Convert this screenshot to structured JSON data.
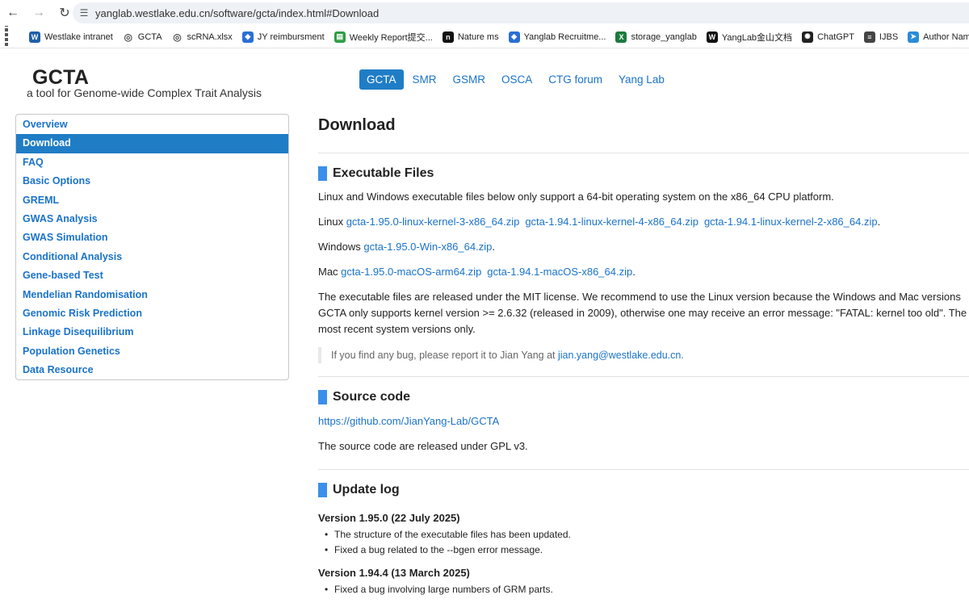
{
  "browser": {
    "url": "yanglab.westlake.edu.cn/software/gcta/index.html#Download",
    "bookmarks": [
      {
        "label": "Westlake intranet",
        "icon": "westlake-icon",
        "color": "#1f5fa8"
      },
      {
        "label": "GCTA",
        "icon": "globe-icon",
        "color": "#555555"
      },
      {
        "label": "scRNA.xlsx",
        "icon": "globe-icon",
        "color": "#555555"
      },
      {
        "label": "JY reimbursment",
        "icon": "cube-icon",
        "color": "#2a6fd6"
      },
      {
        "label": "Weekly Report提交...",
        "icon": "sheet-icon",
        "color": "#2f9e44"
      },
      {
        "label": "Nature ms",
        "icon": "nature-icon",
        "color": "#111111"
      },
      {
        "label": "Yanglab Recruitme...",
        "icon": "cube-icon",
        "color": "#2a6fd6"
      },
      {
        "label": "storage_yanglab",
        "icon": "excel-icon",
        "color": "#1d7a3e"
      },
      {
        "label": "YangLab金山文档",
        "icon": "wps-icon",
        "color": "#111111"
      },
      {
        "label": "ChatGPT",
        "icon": "chatgpt-icon",
        "color": "#222222"
      },
      {
        "label": "IJBS",
        "icon": "ijbs-icon",
        "color": "#444444"
      },
      {
        "label": "Author Name Esti...",
        "icon": "bird-icon",
        "color": "#2a8cd6"
      }
    ]
  },
  "site": {
    "title": "GCTA",
    "subtitle": "a tool for Genome-wide Complex Trait Analysis",
    "nav": [
      {
        "label": "GCTA",
        "active": true
      },
      {
        "label": "SMR",
        "active": false
      },
      {
        "label": "GSMR",
        "active": false
      },
      {
        "label": "OSCA",
        "active": false
      },
      {
        "label": "CTG forum",
        "active": false
      },
      {
        "label": "Yang Lab",
        "active": false
      }
    ]
  },
  "sidebar": {
    "items": [
      {
        "label": "Overview",
        "active": false
      },
      {
        "label": "Download",
        "active": true
      },
      {
        "label": "FAQ",
        "active": false
      },
      {
        "label": "Basic Options",
        "active": false
      },
      {
        "label": "GREML",
        "active": false
      },
      {
        "label": "GWAS Analysis",
        "active": false
      },
      {
        "label": "GWAS Simulation",
        "active": false
      },
      {
        "label": "Conditional Analysis",
        "active": false
      },
      {
        "label": "Gene-based Test",
        "active": false
      },
      {
        "label": "Mendelian Randomisation",
        "active": false
      },
      {
        "label": "Genomic Risk Prediction",
        "active": false
      },
      {
        "label": "Linkage Disequilibrium",
        "active": false
      },
      {
        "label": "Population Genetics",
        "active": false
      },
      {
        "label": "Data Resource",
        "active": false
      }
    ]
  },
  "main": {
    "title": "Download",
    "exec": {
      "heading": "Executable Files",
      "intro": "Linux and Windows executable files below only support a 64-bit operating system on the x86_64 CPU platform.",
      "linux_label": "Linux",
      "linux_links": [
        "gcta-1.95.0-linux-kernel-3-x86_64.zip",
        "gcta-1.94.1-linux-kernel-4-x86_64.zip",
        "gcta-1.94.1-linux-kernel-2-x86_64.zip"
      ],
      "windows_label": "Windows",
      "windows_links": [
        "gcta-1.95.0-Win-x86_64.zip"
      ],
      "mac_label": "Mac",
      "mac_links": [
        "gcta-1.95.0-macOS-arm64.zip",
        "gcta-1.94.1-macOS-x86_64.zip"
      ],
      "period": ".",
      "license_lines": [
        "The executable files are released under the MIT license. We recommend to use the Linux version because the Windows and Mac versions",
        "GCTA only supports kernel version >= 2.6.32 (released in 2009), otherwise one may receive an error message: \"FATAL: kernel too old\". The",
        "most recent system versions only."
      ],
      "bug_text": "If you find any bug, please report it to Jian Yang at ",
      "bug_email": "jian.yang@westlake.edu.cn",
      "bug_end": "."
    },
    "source": {
      "heading": "Source code",
      "link": "https://github.com/JianYang-Lab/GCTA",
      "license": "The source code are released under GPL v3."
    },
    "log": {
      "heading": "Update log",
      "versions": [
        {
          "title": "Version 1.95.0 (22 July 2025)",
          "items": [
            "The structure of the executable files has been updated.",
            "Fixed a bug related to the --bgen error message."
          ]
        },
        {
          "title": "Version 1.94.4 (13 March 2025)",
          "items": [
            "Fixed a bug involving large numbers of GRM parts."
          ]
        }
      ]
    }
  }
}
